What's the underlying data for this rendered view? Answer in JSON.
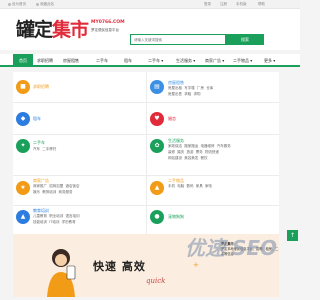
{
  "topbar": {
    "left1": "设为首页",
    "left2": "收藏此站",
    "right": [
      "登录",
      "注册",
      "手机版",
      "帮助"
    ]
  },
  "header": {
    "logo_part1": "罐定",
    "logo_part2": "集市",
    "domain": "MY0766.COM",
    "slogan": "罗定便民信息平台",
    "search_placeholder": "请输入关键词搜索",
    "search_button": "搜索"
  },
  "nav": {
    "items": [
      "首页",
      "求职招聘",
      "房屋租售",
      "二手车",
      "租车",
      "二手车 ▾",
      "生活服务 ▾",
      "商家广告 ▾",
      "二手物品 ▾",
      "更多 ▾"
    ]
  },
  "categories": [
    {
      "icon": "briefcase-icon",
      "color": "#f29b16",
      "title": "求职招聘",
      "subs": []
    },
    {
      "icon": "building-icon",
      "color": "#3b8fe4",
      "title": "房屋租售",
      "subs": [
        "房屋出租",
        "写字楼",
        "厂房",
        "仓库",
        "房屋出售",
        "求租",
        "求购"
      ]
    },
    {
      "icon": "car-icon",
      "color": "#2d7de0",
      "title": "租车",
      "subs": []
    },
    {
      "icon": "wrench-icon",
      "color": "#1aa05b",
      "title": "二手车",
      "subs": [
        "汽车",
        "二手摩托"
      ]
    },
    {
      "icon": "heart-icon",
      "color": "#e12a3a",
      "title": "婚恋",
      "subs": []
    },
    {
      "icon": "leaf-icon",
      "color": "#1aa05b",
      "title": "生活服务",
      "subs": [
        "家政保洁",
        "搬家搬运",
        "电器维修",
        "汽车服务",
        "装修",
        "婚庆",
        "旅游",
        "票务",
        "物流快递",
        "网站建设",
        "美容美发",
        "餐饮"
      ]
    },
    {
      "icon": "store-icon",
      "color": "#f29b16",
      "title": "商家广告",
      "subs": [
        "商家推广",
        "招商加盟",
        "酒店饭店",
        "娱乐",
        "教育培训",
        "商务服务"
      ]
    },
    {
      "icon": "gift-icon",
      "color": "#f29b16",
      "title": "二手物品",
      "subs": [
        "手机",
        "电脑",
        "数码",
        "家具",
        "家电"
      ]
    },
    {
      "icon": "graduation-icon",
      "color": "#2d7de0",
      "title": "教育培训",
      "subs": [
        "儿童教育",
        "职业培训",
        "语言培训",
        "技能培训",
        "IT培训",
        "学历教育"
      ]
    },
    {
      "icon": "paw-icon",
      "color": "#1aa05b",
      "title": "宠物狗狗",
      "subs": []
    }
  ],
  "banner": {
    "headline_1": "快速",
    "headline_2": "高效",
    "quick": "quick",
    "side_title": "罗定集市",
    "side_text": "罗定本地便民信息平台，招聘、租房、二手等信息"
  },
  "watermark": "优速 SEO",
  "backtop": "↑"
}
